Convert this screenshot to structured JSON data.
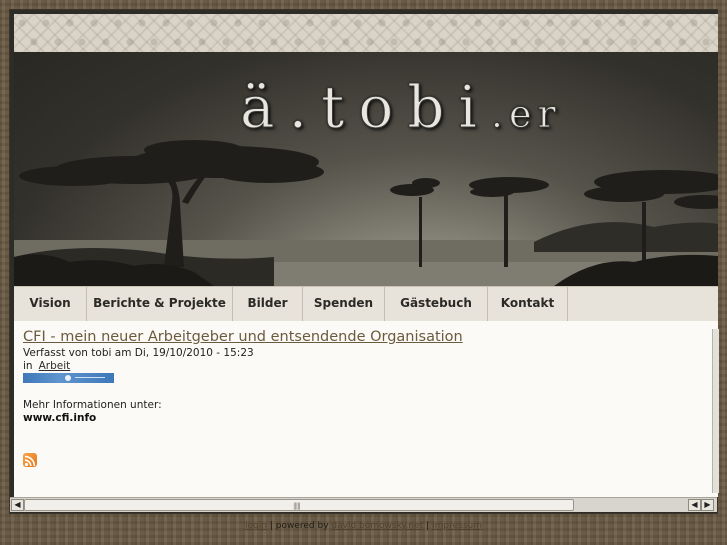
{
  "site": {
    "logo_main": "ä.tobi",
    "logo_suffix": ".er"
  },
  "nav": {
    "items": [
      {
        "label": "Vision"
      },
      {
        "label": "Berichte & Projekte"
      },
      {
        "label": "Bilder"
      },
      {
        "label": "Spenden"
      },
      {
        "label": "Gästebuch"
      },
      {
        "label": "Kontakt"
      }
    ]
  },
  "post": {
    "title": "CFI - mein neuer Arbeitgeber und entsendende Organisation",
    "meta": "Verfasst von tobi am Di, 19/10/2010 - 15:23",
    "tags_prefix": "in",
    "tag": "Arbeit",
    "more_label": "Mehr Informationen unter:",
    "more_url": "www.cfi.info"
  },
  "footer": {
    "login": "login",
    "sep1": "|",
    "powered_by": "powered by",
    "powered_link": "david bomowsky.net",
    "sep2": "|",
    "impressum": "Impressum"
  },
  "icons": {
    "rss": "rss-feed-icon",
    "scroll_left": "arrow-left-icon",
    "scroll_right": "arrow-right-icon"
  },
  "colors": {
    "nav_bg": "#e7e3da",
    "link": "#6b5a3e",
    "rss": "#e5761d"
  }
}
